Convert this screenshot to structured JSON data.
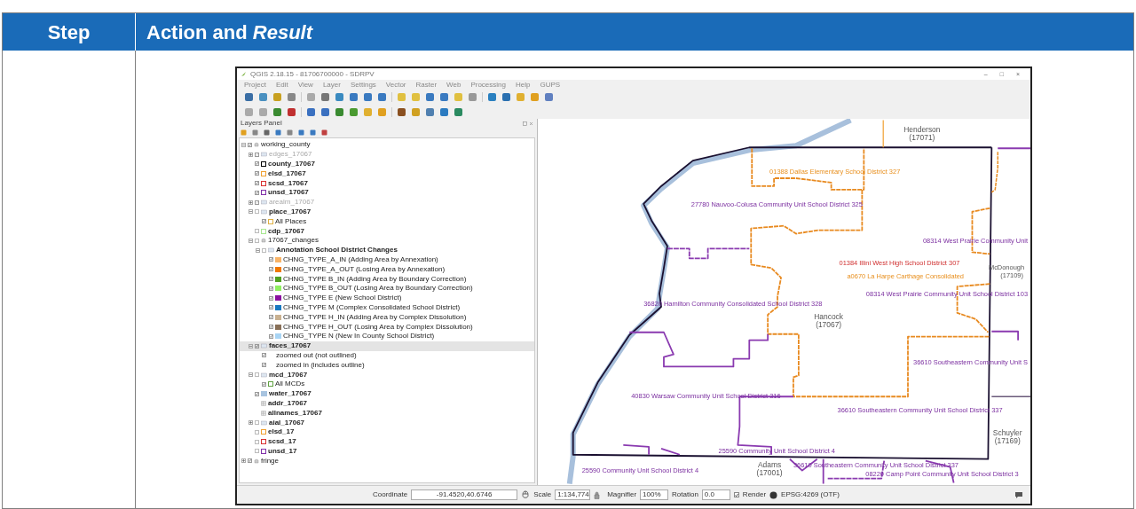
{
  "table": {
    "headers": [
      "Step",
      "Action and *Result*"
    ]
  },
  "window": {
    "title": "QGIS 2.18.15 - 81706700000 - SDRPV",
    "controls": [
      "–",
      "□",
      "×"
    ]
  },
  "menu": [
    "Project",
    "Edit",
    "View",
    "Layer",
    "Settings",
    "Vector",
    "Raster",
    "Web",
    "Processing",
    "Help",
    "GUPS"
  ],
  "layers_panel": {
    "title": "Layers Panel",
    "tree": [
      {
        "label": "working_county",
        "kind": "group",
        "checked": true,
        "expanded": true,
        "bold": false,
        "disabled": false,
        "selected": false,
        "children": [
          {
            "label": "edges_17067",
            "kind": "vector",
            "checked": true,
            "expanded": false,
            "bold": false,
            "disabled": true,
            "selected": false
          },
          {
            "label": "county_17067",
            "kind": "polygon",
            "color": "#000000",
            "checked": true,
            "bold": true,
            "disabled": false,
            "selected": false
          },
          {
            "label": "elsd_17067",
            "kind": "polygon",
            "color": "#f0a030",
            "checked": true,
            "bold": true,
            "disabled": false,
            "selected": false
          },
          {
            "label": "scsd_17067",
            "kind": "polygon",
            "color": "#d83030",
            "checked": true,
            "bold": true,
            "disabled": false,
            "selected": false
          },
          {
            "label": "unsd_17067",
            "kind": "polygon",
            "color": "#8030a8",
            "checked": true,
            "bold": true,
            "disabled": false,
            "selected": false
          },
          {
            "label": "arealm_17067",
            "kind": "vector",
            "checked": true,
            "expanded": false,
            "bold": false,
            "disabled": true,
            "selected": false
          },
          {
            "label": "place_17067",
            "kind": "vector",
            "checked": false,
            "expanded": true,
            "bold": true,
            "disabled": false,
            "selected": false,
            "children": [
              {
                "label": "All Places",
                "kind": "polygon",
                "color": "#e0b040",
                "checked": true,
                "bold": false,
                "disabled": false,
                "selected": false
              }
            ]
          },
          {
            "label": "cdp_17067",
            "kind": "polygon",
            "color": "#a8e890",
            "checked": false,
            "bold": true,
            "disabled": false,
            "selected": false
          },
          {
            "label": "17067_changes",
            "kind": "group",
            "checked": false,
            "expanded": true,
            "bold": false,
            "disabled": false,
            "selected": false,
            "children": [
              {
                "label": "Annotation School District Changes",
                "kind": "vector",
                "checked": false,
                "expanded": true,
                "bold": true,
                "disabled": false,
                "selected": false,
                "children": [
                  {
                    "label": "CHNG_TYPE_A_IN (Adding Area by Annexation)",
                    "kind": "class",
                    "color": "#f8b468",
                    "checked": true,
                    "bold": false,
                    "disabled": false,
                    "selected": false
                  },
                  {
                    "label": "CHNG_TYPE_A_OUT (Losing Area by Annexation)",
                    "kind": "class",
                    "color": "#f07800",
                    "checked": true,
                    "bold": false,
                    "disabled": false,
                    "selected": false
                  },
                  {
                    "label": "CHNG_TYPE B_IN (Adding Area by Boundary Correction)",
                    "kind": "class",
                    "color": "#50a020",
                    "checked": true,
                    "bold": false,
                    "disabled": false,
                    "selected": false
                  },
                  {
                    "label": "CHNG_TYPE B_OUT (Losing Area by Boundary Correction)",
                    "kind": "class",
                    "color": "#90f060",
                    "checked": true,
                    "bold": false,
                    "disabled": false,
                    "selected": false
                  },
                  {
                    "label": "CHNG_TYPE E (New School District)",
                    "kind": "class",
                    "color": "#8a10a0",
                    "checked": true,
                    "bold": false,
                    "disabled": false,
                    "selected": false
                  },
                  {
                    "label": "CHNG_TYPE M (Complex Consolidated School District)",
                    "kind": "class",
                    "color": "#1878c0",
                    "checked": true,
                    "bold": false,
                    "disabled": false,
                    "selected": false
                  },
                  {
                    "label": "CHNG_TYPE H_IN (Adding Area by Complex Dissolution)",
                    "kind": "class",
                    "color": "#c8b090",
                    "checked": true,
                    "bold": false,
                    "disabled": false,
                    "selected": false
                  },
                  {
                    "label": "CHNG_TYPE H_OUT (Losing Area by Complex Dissolution)",
                    "kind": "class",
                    "color": "#887058",
                    "checked": true,
                    "bold": false,
                    "disabled": false,
                    "selected": false
                  },
                  {
                    "label": "CHNG_TYPE N (New In County School District)",
                    "kind": "class",
                    "color": "#a8d4f4",
                    "checked": true,
                    "bold": false,
                    "disabled": false,
                    "selected": false
                  }
                ]
              }
            ]
          },
          {
            "label": "faces_17067",
            "kind": "vector",
            "checked": true,
            "expanded": true,
            "bold": true,
            "disabled": false,
            "selected": true,
            "children": [
              {
                "label": "zoomed out (not outlined)",
                "kind": "rule",
                "checked": true,
                "bold": false,
                "disabled": false,
                "selected": false
              },
              {
                "label": "zoomed in (includes outline)",
                "kind": "rule",
                "checked": true,
                "bold": false,
                "disabled": false,
                "selected": false
              }
            ]
          },
          {
            "label": "mcd_17067",
            "kind": "vector",
            "checked": false,
            "expanded": true,
            "bold": true,
            "disabled": false,
            "selected": false,
            "children": [
              {
                "label": "All MCDs",
                "kind": "polygon",
                "color": "#60a040",
                "checked": true,
                "bold": false,
                "disabled": false,
                "selected": false
              }
            ]
          },
          {
            "label": "water_17067",
            "kind": "class",
            "color": "#a8c4e0",
            "checked": true,
            "bold": true,
            "disabled": false,
            "selected": false
          },
          {
            "label": "addr_17067",
            "kind": "table",
            "bold": true,
            "disabled": false,
            "selected": false
          },
          {
            "label": "allnames_17067",
            "kind": "table",
            "bold": true,
            "disabled": false,
            "selected": false
          },
          {
            "label": "aial_17067",
            "kind": "vector",
            "checked": false,
            "expanded": false,
            "bold": true,
            "disabled": false,
            "selected": false
          },
          {
            "label": "elsd_17",
            "kind": "polygon",
            "color": "#f0a030",
            "checked": false,
            "bold": true,
            "disabled": false,
            "selected": false
          },
          {
            "label": "scsd_17",
            "kind": "polygon",
            "color": "#d83030",
            "checked": false,
            "bold": true,
            "disabled": false,
            "selected": false
          },
          {
            "label": "unsd_17",
            "kind": "polygon",
            "color": "#8030a8",
            "checked": false,
            "bold": true,
            "disabled": false,
            "selected": false
          }
        ]
      },
      {
        "label": "fringe",
        "kind": "group",
        "checked": true,
        "expanded": false,
        "bold": false,
        "disabled": false,
        "selected": false
      }
    ]
  },
  "map": {
    "labels": [
      {
        "text": "Henderson",
        "kind": "county"
      },
      {
        "text": "(17071)",
        "kind": "county"
      },
      {
        "text": "01388 Dallas Elementary School District 327",
        "kind": "elementary"
      },
      {
        "text": "27780 Nauvoo-Colusa Community Unit School District 325",
        "kind": "unified"
      },
      {
        "text": "01384 Illini West High School District 307",
        "kind": "secondary"
      },
      {
        "text": "a0670 La Harpe Carthage Consolidated",
        "kind": "elementary"
      },
      {
        "text": "08314 West Prairie Community Unit",
        "kind": "unified"
      },
      {
        "text": "McDonough",
        "kind": "county"
      },
      {
        "text": "(17109)",
        "kind": "county"
      },
      {
        "text": "36820 Hamilton Community Consolidated School District 328",
        "kind": "unified"
      },
      {
        "text": "Hancock",
        "kind": "county"
      },
      {
        "text": "(17067)",
        "kind": "county"
      },
      {
        "text": "08314 West Prairie Community Unit School District 103",
        "kind": "unified"
      },
      {
        "text": "36610 Southeastern Community Unit S",
        "kind": "unified"
      },
      {
        "text": "40830 Warsaw Community Unit School District 316",
        "kind": "unified"
      },
      {
        "text": "36610 Southeastern Community Unit School District 337",
        "kind": "unified"
      },
      {
        "text": "Schuyler",
        "kind": "county"
      },
      {
        "text": "(17169)",
        "kind": "county"
      },
      {
        "text": "25590 Community Unit School District 4",
        "kind": "unified"
      },
      {
        "text": "25590 Community Unit School District 4",
        "kind": "unified"
      },
      {
        "text": "Adams",
        "kind": "county"
      },
      {
        "text": "(17001)",
        "kind": "county"
      },
      {
        "text": "36610 Southeastern Community Unit School District 337",
        "kind": "unified"
      },
      {
        "text": "08220 Camp Point Community Unit School District 3",
        "kind": "unified"
      }
    ]
  },
  "status_bar": {
    "coordinate_label": "Coordinate",
    "coordinate_value": "-91.4520,40.6746",
    "scale_label": "Scale",
    "scale_value": "1:134,774",
    "magnifier_label": "Magnifier",
    "magnifier_value": "100%",
    "rotation_label": "Rotation",
    "rotation_value": "0.0",
    "render_label": "Render",
    "render_checked": true,
    "crs": "EPSG:4269 (OTF)"
  }
}
